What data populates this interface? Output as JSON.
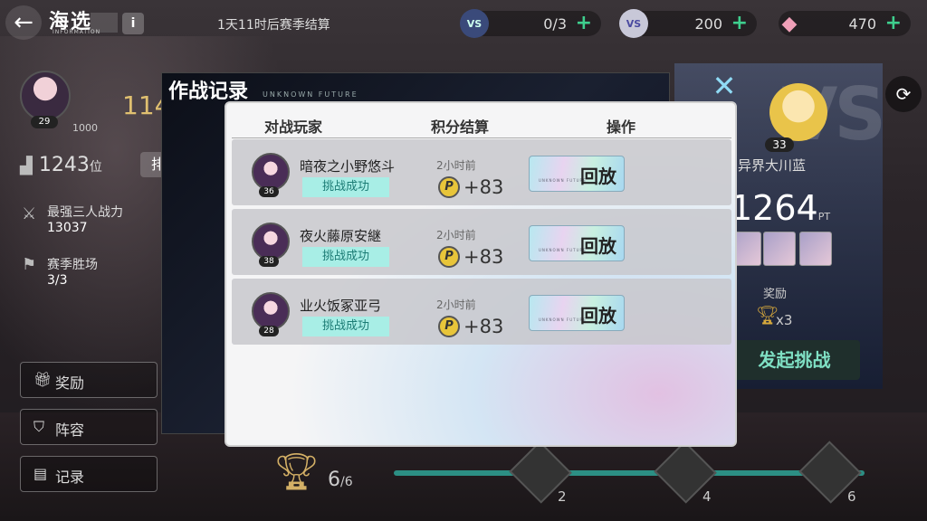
{
  "header": {
    "title": "海选",
    "subtitle": "INFORMATION",
    "info_label": "i",
    "season_text": "1天11时后赛季结算",
    "resources": [
      {
        "icon": "vs-ticket-icon",
        "value": "0/3",
        "plus": "+"
      },
      {
        "icon": "vs-coin-icon",
        "value": "200",
        "plus": "+"
      },
      {
        "icon": "crystal-icon",
        "value": "470",
        "plus": "+"
      }
    ]
  },
  "player": {
    "level": "29",
    "big_number": "114",
    "exp": "1000",
    "rank": "1243",
    "rank_unit": "位",
    "rank_button": "排",
    "power_label": "最强三人战力",
    "power_value": "13037",
    "wins_label": "赛季胜场",
    "wins_value": "3/3"
  },
  "menu": [
    {
      "icon": "gift-icon",
      "label": "奖励"
    },
    {
      "icon": "shield-icon",
      "label": "阵容"
    },
    {
      "icon": "record-icon",
      "label": "记录"
    }
  ],
  "opponent": {
    "level": "33",
    "name": "异界大川蓝",
    "points": "1264",
    "unit": "PT",
    "reward_label": "奖励",
    "reward_count": "x3",
    "challenge_label": "发起挑战"
  },
  "bottom": {
    "trophy_count": "6",
    "trophy_total": "/6",
    "milestones": [
      "2",
      "4",
      "6"
    ]
  },
  "dialog": {
    "title": "作战记录",
    "subtitle": "UNKNOWN FUTURE",
    "close_label": "✕",
    "columns": [
      "对战玩家",
      "积分结算",
      "操作"
    ],
    "records": [
      {
        "level": "36",
        "name": "暗夜之小野悠斗",
        "status": "挑战成功",
        "time": "2小时前",
        "coin": "P",
        "score": "+83",
        "action": "回放",
        "action_sub": "UNKNOWN FUTURE"
      },
      {
        "level": "38",
        "name": "夜火藤原安継",
        "status": "挑战成功",
        "time": "2小时前",
        "coin": "P",
        "score": "+83",
        "action": "回放",
        "action_sub": "UNKNOWN FUTURE"
      },
      {
        "level": "28",
        "name": "业火饭冢亚弓",
        "status": "挑战成功",
        "time": "2小时前",
        "coin": "P",
        "score": "+83",
        "action": "回放",
        "action_sub": "UNKNOWN FUTURE"
      }
    ]
  }
}
